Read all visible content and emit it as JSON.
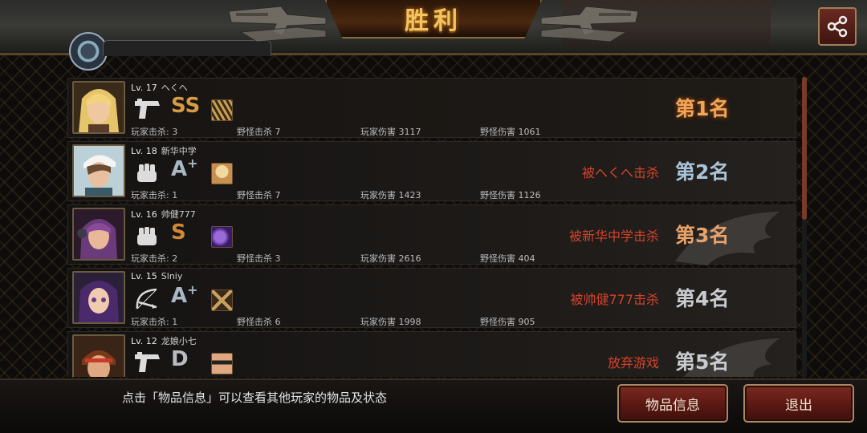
{
  "title": "胜利",
  "players": [
    {
      "level": "Lv. 17",
      "name": "へくへ",
      "weapon_icon": "pistol-icon",
      "grade": "SS",
      "grade_sup": "",
      "player_kills": "玩家击杀: 3",
      "monster_kills": "野怪击杀 7",
      "player_damage": "玩家伤害 3117",
      "monster_damage": "野怪伤害 1061",
      "killed_by": "",
      "rank": "第1名"
    },
    {
      "level": "Lv. 18",
      "name": "新华中学",
      "weapon_icon": "fist-icon",
      "grade": "A",
      "grade_sup": "+",
      "player_kills": "玩家击杀: 1",
      "monster_kills": "野怪击杀 7",
      "player_damage": "玩家伤害 1423",
      "monster_damage": "野怪伤害 1126",
      "killed_by": "被へくへ击杀",
      "rank": "第2名"
    },
    {
      "level": "Lv. 16",
      "name": "帅健777",
      "weapon_icon": "fist-icon",
      "grade": "S",
      "grade_sup": "",
      "player_kills": "玩家击杀: 2",
      "monster_kills": "野怪击杀 3",
      "player_damage": "玩家伤害 2616",
      "monster_damage": "野怪伤害 404",
      "killed_by": "被新华中学击杀",
      "rank": "第3名"
    },
    {
      "level": "Lv. 15",
      "name": "Slniy",
      "weapon_icon": "bow-icon",
      "grade": "A",
      "grade_sup": "+",
      "player_kills": "玩家击杀: 1",
      "monster_kills": "野怪击杀 6",
      "player_damage": "玩家伤害 1998",
      "monster_damage": "野怪伤害 905",
      "killed_by": "被帅健777击杀",
      "rank": "第4名"
    },
    {
      "level": "Lv. 12",
      "name": "龙娘小七",
      "weapon_icon": "pistol-icon",
      "grade": "D",
      "grade_sup": "",
      "player_kills": "",
      "monster_kills": "",
      "player_damage": "",
      "monster_damage": "",
      "killed_by": "放弃游戏",
      "rank": "第5名"
    }
  ],
  "hint": "点击「物品信息」可以查看其他玩家的物品及状态",
  "buttons": {
    "items": "物品信息",
    "exit": "退出"
  },
  "colors": {
    "accent": "#f3c562",
    "killed_text": "#d4432c",
    "button": "#6a1e18"
  }
}
